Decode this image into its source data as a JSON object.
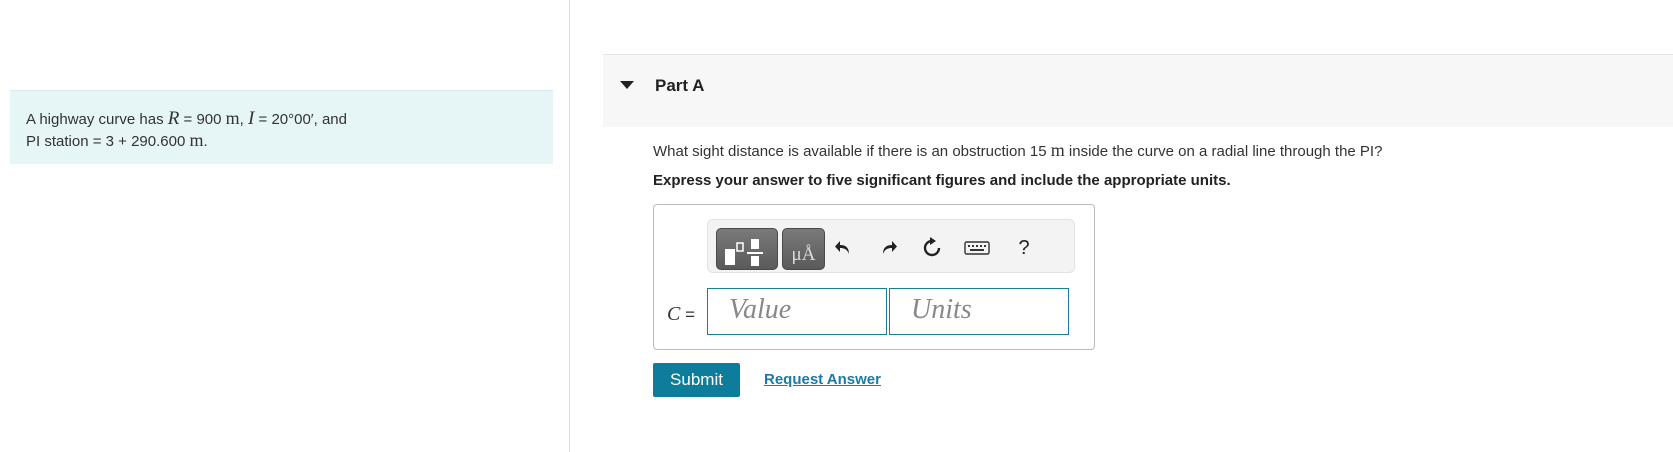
{
  "problem": {
    "text_prefix": "A highway curve has ",
    "R_symbol": "R",
    "R_eq": " = 900 ",
    "R_unit": "m",
    "sep": ", ",
    "I_symbol": "I",
    "I_eq": " = 20°00′, and",
    "line2_prefix": "PI station = 3 + 290.600 ",
    "line2_unit": "m",
    "line2_suffix": "."
  },
  "part": {
    "title": "Part A",
    "question_prefix": "What sight distance is available if there is an obstruction 15 ",
    "question_unit": "m",
    "question_suffix": " inside the curve on a radial line through the PI?",
    "instruction": "Express your answer to five significant figures and include the appropriate units."
  },
  "toolbar": {
    "units_glyph": "μÅ",
    "help_glyph": "?",
    "icons": [
      "templates-icon",
      "units-icon",
      "undo-icon",
      "redo-icon",
      "reset-icon",
      "keyboard-icon",
      "help-icon"
    ]
  },
  "answer": {
    "variable": "C",
    "equals": " =",
    "value_placeholder": "Value",
    "units_placeholder": "Units"
  },
  "actions": {
    "submit_label": "Submit",
    "request_label": "Request Answer"
  },
  "colors": {
    "problem_bg": "#e6f5f6",
    "submit_bg": "#0e7c9b",
    "link": "#1a7aa8",
    "field_border": "#1c7c91"
  }
}
